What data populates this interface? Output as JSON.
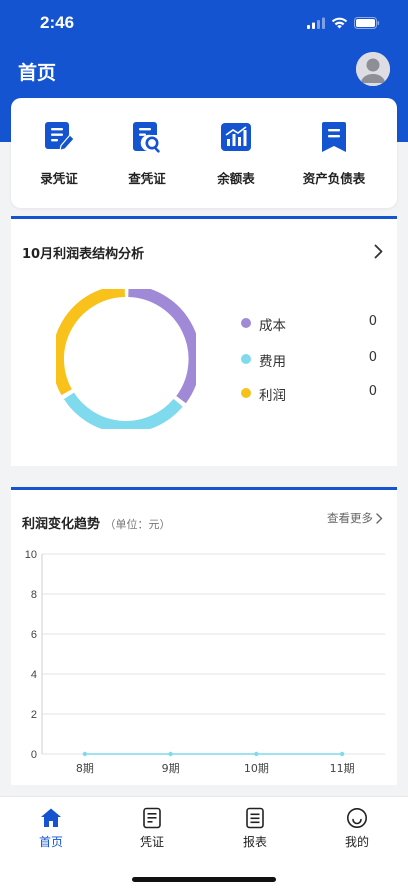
{
  "status_bar": {
    "time": "2:46"
  },
  "header": {
    "title": "首页"
  },
  "quick_actions": [
    {
      "label": "录凭证",
      "icon": "edit-voucher-icon"
    },
    {
      "label": "查凭证",
      "icon": "search-voucher-icon"
    },
    {
      "label": "余额表",
      "icon": "bar-chart-icon"
    },
    {
      "label": "资产负债表",
      "icon": "bookmark-doc-icon"
    }
  ],
  "profit_structure": {
    "title": "10月利润表结构分析",
    "legend": [
      {
        "label": "成本",
        "value": "0",
        "color": "#a08ad8"
      },
      {
        "label": "费用",
        "value": "0",
        "color": "#7fdaee"
      },
      {
        "label": "利润",
        "value": "0",
        "color": "#f8c21b"
      }
    ]
  },
  "trend": {
    "title": "利润变化趋势",
    "unit": "（单位：元）",
    "more_label": "查看更多"
  },
  "chart_data": {
    "type": "line",
    "categories": [
      "8期",
      "9期",
      "10期",
      "11期"
    ],
    "series": [
      {
        "values": [
          0,
          0,
          0,
          0
        ],
        "color": "#7fdaee"
      }
    ],
    "yticks": [
      "10",
      "8",
      "6",
      "4",
      "2",
      "0"
    ],
    "ylim": [
      0,
      10
    ],
    "grid": true
  },
  "tabbar": {
    "items": [
      {
        "label": "首页",
        "icon": "home-icon",
        "active": true
      },
      {
        "label": "凭证",
        "icon": "voucher-icon",
        "active": false
      },
      {
        "label": "报表",
        "icon": "report-icon",
        "active": false
      },
      {
        "label": "我的",
        "icon": "smile-icon",
        "active": false
      }
    ]
  },
  "colors": {
    "primary": "#1554d1",
    "background": "#f2f3f5"
  }
}
